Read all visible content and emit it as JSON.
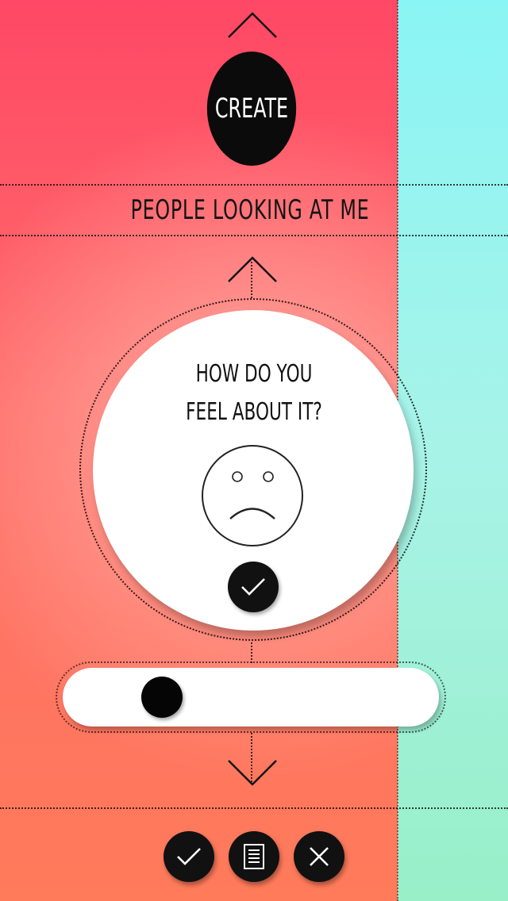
{
  "header": {
    "create_label": "CREATE",
    "section_title": "PEOPLE LOOKING AT ME"
  },
  "card": {
    "question_line1": "HOW DO YOU",
    "question_line2": "FEEL ABOUT IT?",
    "mood_icon": "sad-face-icon",
    "confirm_icon": "checkmark-icon"
  },
  "slider": {
    "value": 0.22
  },
  "actions": {
    "accept_icon": "checkmark-icon",
    "document_icon": "document-icon",
    "close_icon": "close-icon"
  },
  "colors": {
    "left_panel": "#ff5a68",
    "right_panel": "#9ef3e0",
    "button": "#111111",
    "card": "#ffffff"
  }
}
